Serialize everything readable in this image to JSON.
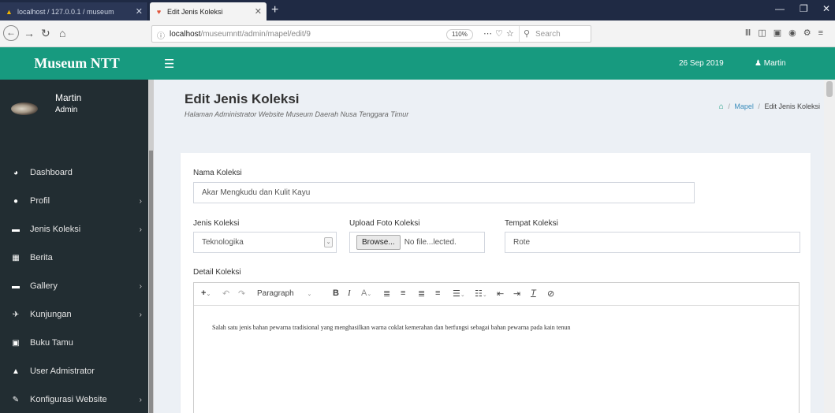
{
  "browser": {
    "tabs": [
      {
        "title": "localhost / 127.0.0.1 / museum",
        "active": false
      },
      {
        "title": "Edit Jenis Koleksi",
        "active": true
      }
    ],
    "url_host": "localhost",
    "url_path": "/museumntt/admin/mapel/edit/9",
    "zoom": "110%",
    "search_placeholder": "Search"
  },
  "sidebar": {
    "brand": "Museum NTT",
    "user_name": "Martin",
    "user_role": "Admin",
    "items": [
      {
        "label": "Dashboard",
        "icon": "dashboard-icon",
        "arrow": false
      },
      {
        "label": "Profil",
        "icon": "profile-icon",
        "arrow": true
      },
      {
        "label": "Jenis Koleksi",
        "icon": "list-icon",
        "arrow": true
      },
      {
        "label": "Berita",
        "icon": "news-icon",
        "arrow": false
      },
      {
        "label": "Gallery",
        "icon": "gallery-icon",
        "arrow": true
      },
      {
        "label": "Kunjungan",
        "icon": "visit-icon",
        "arrow": true
      },
      {
        "label": "Buku Tamu",
        "icon": "guestbook-icon",
        "arrow": false
      },
      {
        "label": "User Admistrator",
        "icon": "lock-icon",
        "arrow": false
      },
      {
        "label": "Konfigurasi Website",
        "icon": "wrench-icon",
        "arrow": true
      }
    ]
  },
  "header": {
    "date": "26 Sep 2019",
    "user": "Martin"
  },
  "page": {
    "title": "Edit Jenis Koleksi",
    "subtitle": "Halaman Administrator Website Museum Daerah Nusa Tenggara Timur",
    "breadcrumb": [
      "Mapel",
      "Edit Jenis Koleksi"
    ]
  },
  "form": {
    "nama_label": "Nama Koleksi",
    "nama_value": "Akar Mengkudu dan Kulit Kayu",
    "jenis_label": "Jenis Koleksi",
    "jenis_value": "Teknologika",
    "upload_label": "Upload Foto Koleksi",
    "browse_label": "Browse...",
    "no_file_text": "No file...lected.",
    "tempat_label": "Tempat Koleksi",
    "tempat_value": "Rote",
    "detail_label": "Detail Koleksi",
    "editor_format": "Paragraph",
    "detail_text": "Salah satu jenis bahan pewarna tradisional yang menghasilkan warna coklat kemerahan dan berfungsi sebagai bahan pewarna pada kain tenun"
  },
  "colors": {
    "accent": "#179a7f",
    "sidebar_bg": "#222d32",
    "content_bg": "#ecf0f5"
  }
}
